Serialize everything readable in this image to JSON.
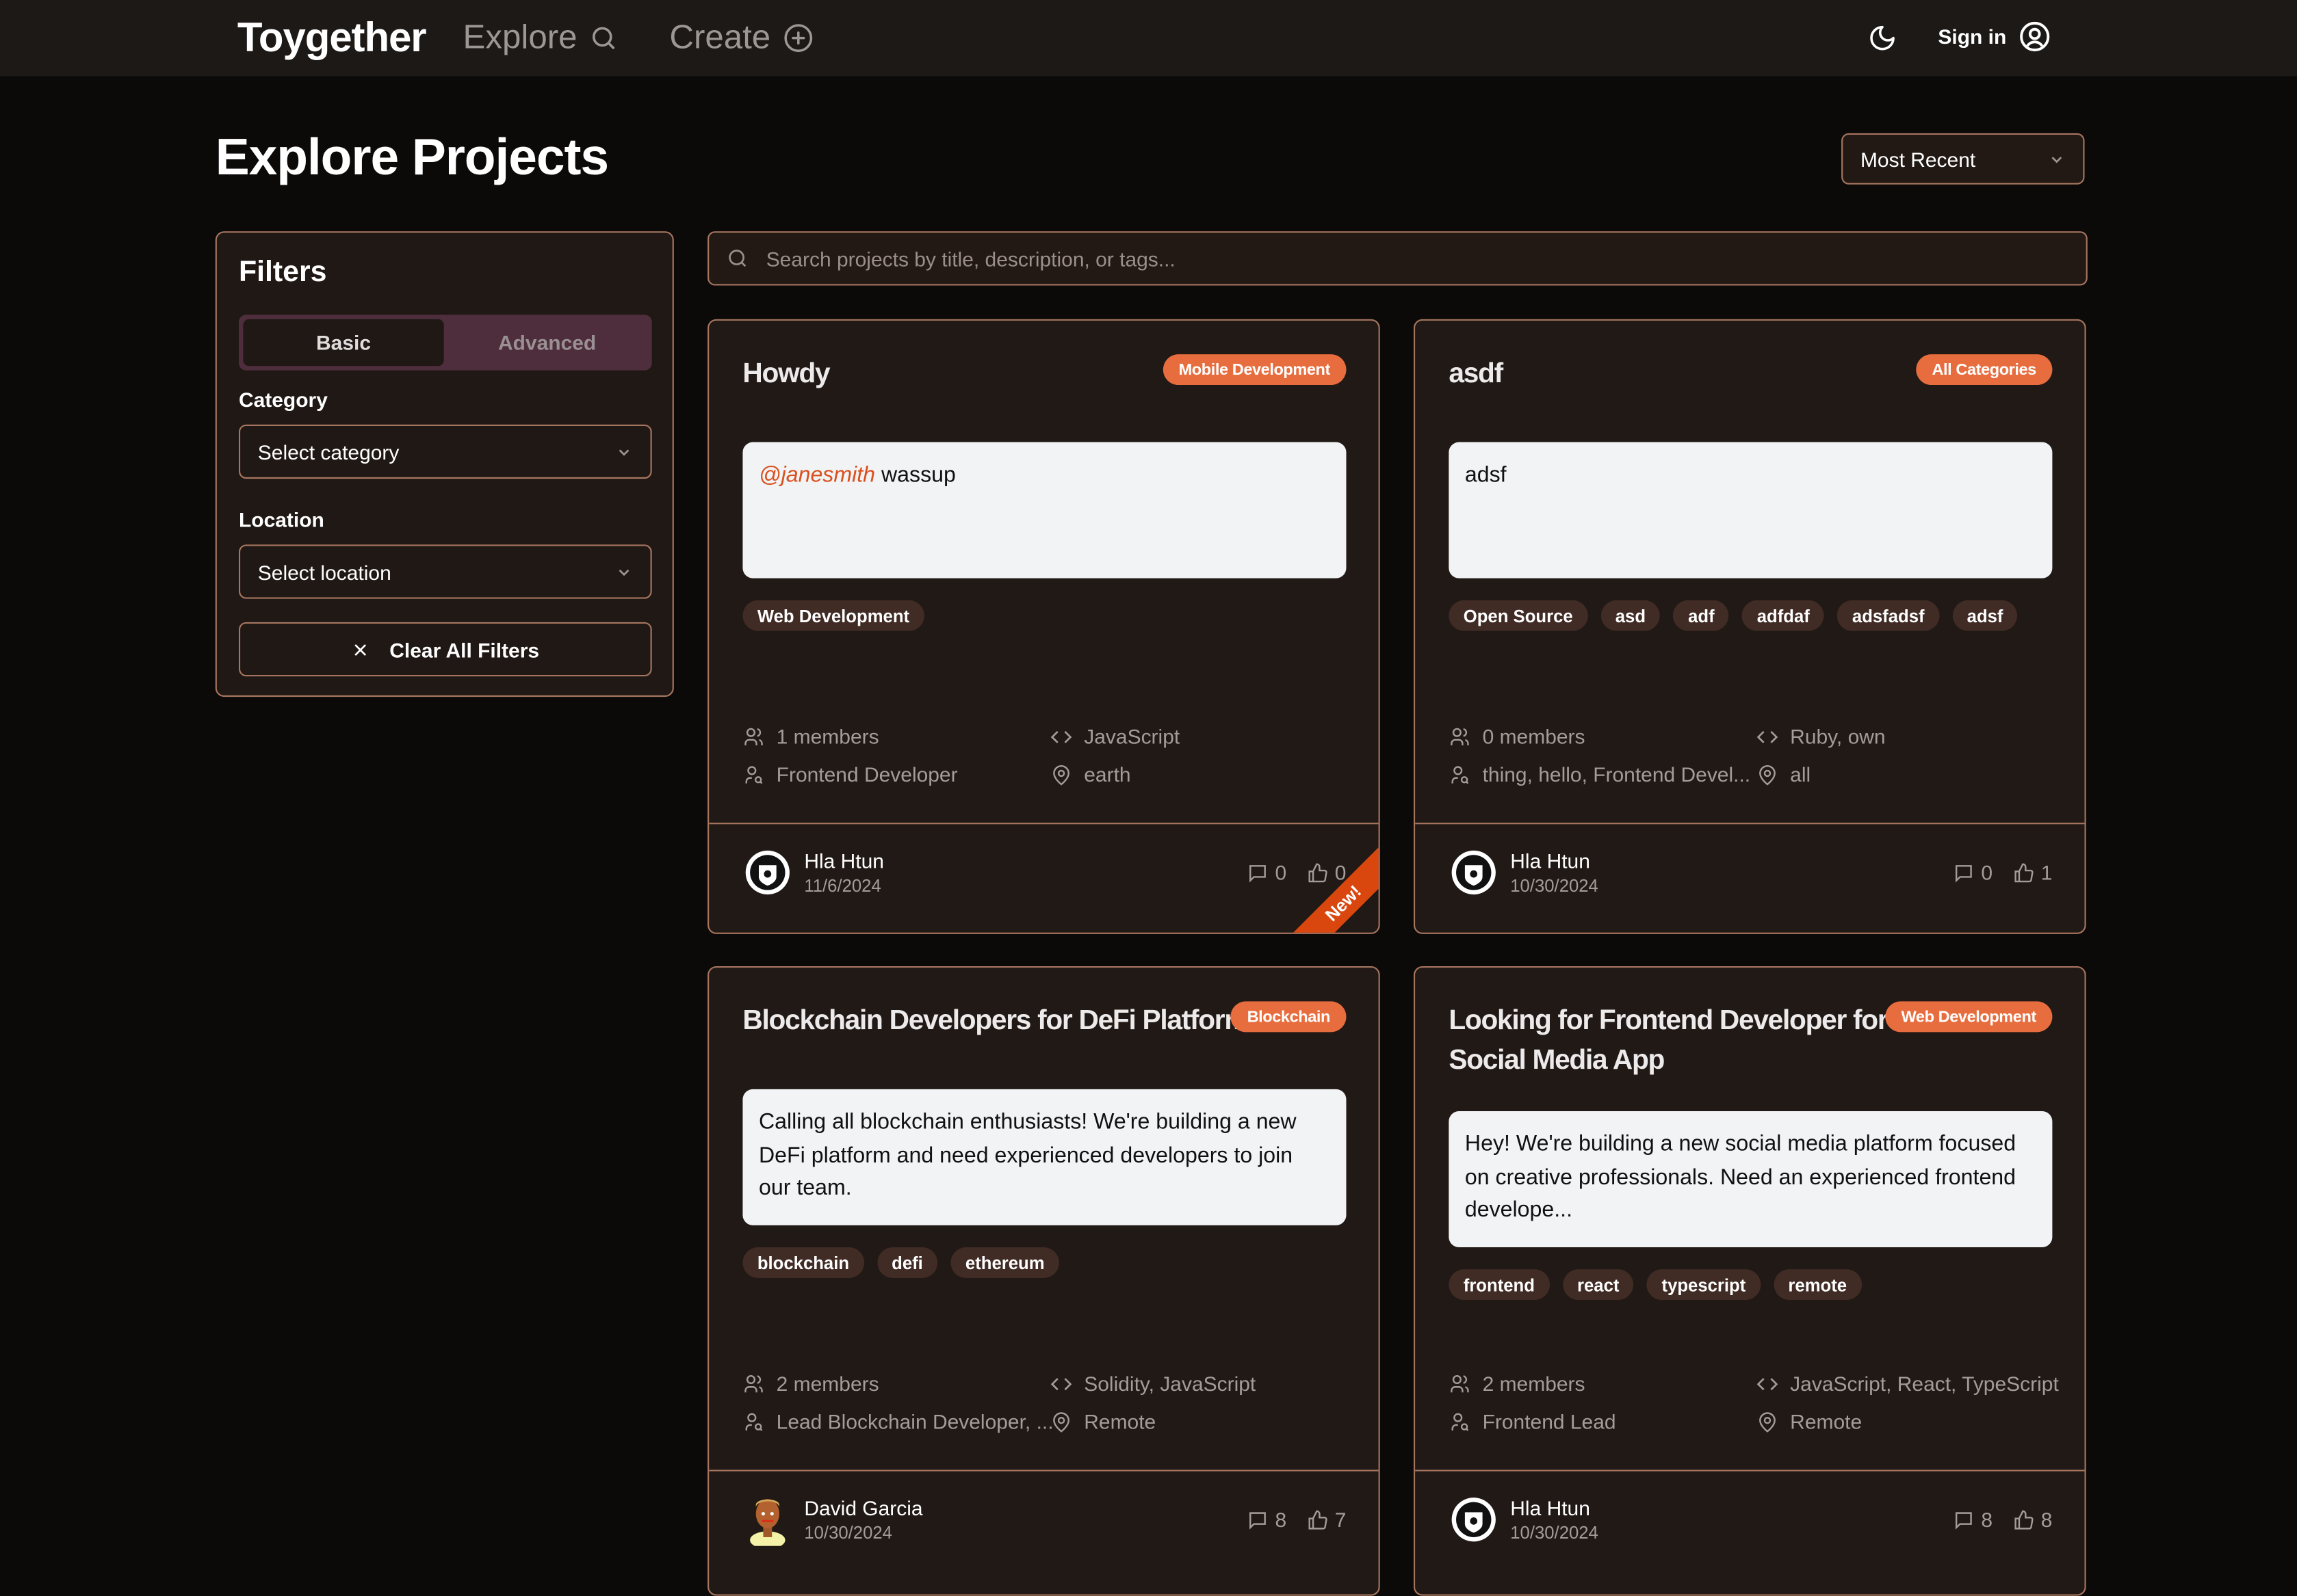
{
  "nav": {
    "brand": "Toygether",
    "explore_label": "Explore",
    "create_label": "Create",
    "signin_label": "Sign in"
  },
  "page": {
    "title": "Explore Projects",
    "sort_selected": "Most Recent"
  },
  "filters": {
    "title": "Filters",
    "tabs": [
      {
        "label": "Basic",
        "active": true
      },
      {
        "label": "Advanced",
        "active": false
      }
    ],
    "category_label": "Category",
    "category_placeholder": "Select category",
    "location_label": "Location",
    "location_placeholder": "Select location",
    "clear_label": "Clear All Filters"
  },
  "search": {
    "placeholder": "Search projects by title, description, or tags..."
  },
  "colors": {
    "accent": "#e86d3e",
    "border": "#a6755f",
    "card_bg": "#211915",
    "page_bg": "#0c0a09",
    "ribbon": "#d9470f"
  },
  "projects": [
    {
      "title": "Howdy",
      "category": "Mobile Development",
      "description_mention": "@janesmith",
      "description": "wassup",
      "tags": [
        "Web Development"
      ],
      "members": "1 members",
      "languages": "JavaScript",
      "roles": "Frontend Developer",
      "location": "earth",
      "author": "Hla Htun",
      "date": "11/6/2024",
      "comments": "0",
      "likes": "0",
      "badge": "New!"
    },
    {
      "title": "asdf",
      "category": "All Categories",
      "description": "adsf",
      "tags": [
        "Open Source",
        "asd",
        "adf",
        "adfdaf",
        "adsfadsf",
        "adsf"
      ],
      "members": "0 members",
      "languages": "Ruby, own",
      "roles": "thing, hello, Frontend Devel...",
      "location": "all",
      "author": "Hla Htun",
      "date": "10/30/2024",
      "comments": "0",
      "likes": "1"
    },
    {
      "title": "Blockchain Developers for DeFi Platform",
      "category": "Blockchain",
      "description": "Calling all blockchain enthusiasts! We're building a new DeFi platform and need experienced developers to join our team.",
      "tags": [
        "blockchain",
        "defi",
        "ethereum"
      ],
      "members": "2 members",
      "languages": "Solidity, JavaScript",
      "roles": "Lead Blockchain Developer, ...",
      "location": "Remote",
      "author": "David Garcia",
      "date": "10/30/2024",
      "comments": "8",
      "likes": "7"
    },
    {
      "title": "Looking for Frontend Developer for Social Media App",
      "category": "Web Development",
      "description": "Hey! We're building a new social media platform focused on creative professionals. Need an experienced frontend develope...",
      "tags": [
        "frontend",
        "react",
        "typescript",
        "remote"
      ],
      "members": "2 members",
      "languages": "JavaScript, React, TypeScript",
      "roles": "Frontend Lead",
      "location": "Remote",
      "author": "Hla Htun",
      "date": "10/30/2024",
      "comments": "8",
      "likes": "8"
    }
  ]
}
